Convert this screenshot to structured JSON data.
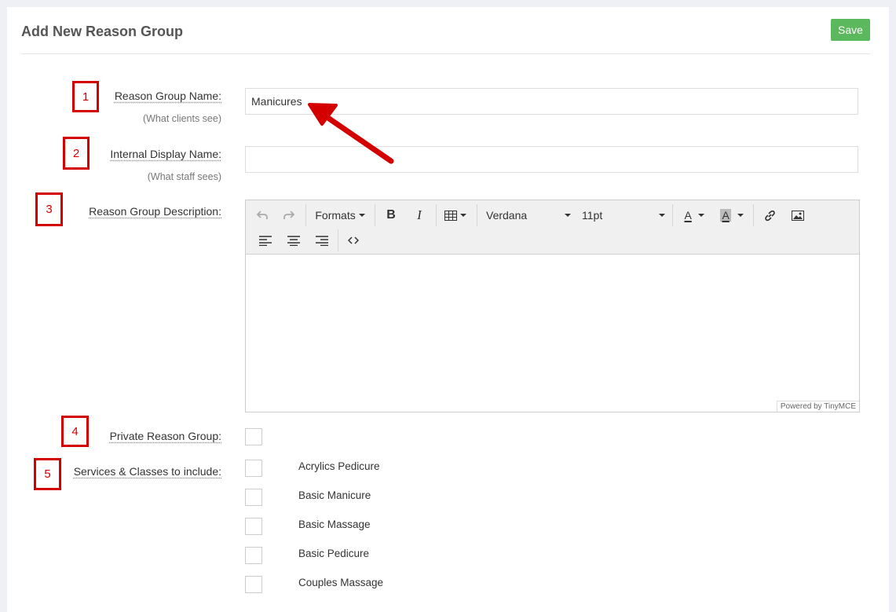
{
  "page": {
    "title": "Add New Reason Group",
    "save_label": "Save"
  },
  "fields": {
    "name": {
      "label": "Reason Group Name:",
      "sublabel": "(What clients see)",
      "value": "Manicures"
    },
    "internal": {
      "label": "Internal Display Name:",
      "sublabel": "(What staff sees)",
      "value": ""
    },
    "description": {
      "label": "Reason Group Description:"
    },
    "private": {
      "label": "Private Reason Group:"
    },
    "services": {
      "label": "Services & Classes to include:"
    }
  },
  "editor": {
    "formats_label": "Formats",
    "font_family": "Verdana",
    "font_size": "11pt",
    "powered_by": "Powered by TinyMCE"
  },
  "annotations": [
    "1",
    "2",
    "3",
    "4",
    "5"
  ],
  "services": [
    "Acrylics Pedicure",
    "Basic Manicure",
    "Basic Massage",
    "Basic Pedicure",
    "Couples Massage"
  ],
  "colors": {
    "save": "#5cb85c",
    "annotation": "#d40000"
  }
}
